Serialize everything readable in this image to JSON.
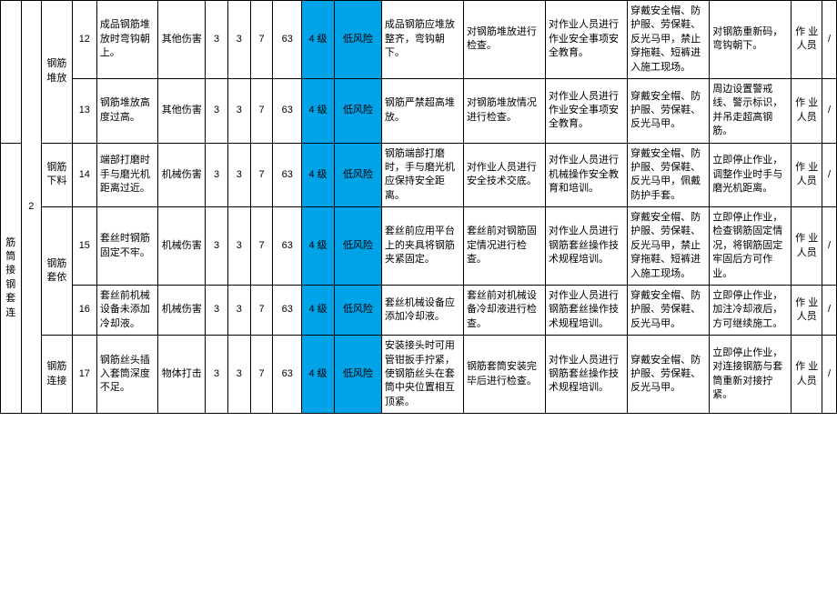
{
  "group2_id": "2",
  "group2_name": "筋 筒 接 钢 套 连",
  "subgroup_a": "钢筋 堆放",
  "subgroup_b1": "钢筋 下料",
  "subgroup_b2": "钢筋 套依",
  "subgroup_b3": "钢筋 连接",
  "rows": [
    {
      "idx": "12",
      "c4": "成品钢筋堆放时弯钩朝上。",
      "c5": "其他伤害",
      "c6": "3",
      "c7": "3",
      "c8": "7",
      "c9": "63",
      "c10": "4 级",
      "c11": "低风险",
      "c12": "成品钢筋应堆放整齐，弯钩朝下。",
      "c13": "对钢筋堆放进行检查。",
      "c14": "对作业人员进行作业安全事项安全教育。",
      "c15": "穿戴安全帽、防护服、劳保鞋、反光马甲，禁止穿拖鞋、短裤进入施工现场。",
      "c16": "对钢筋重新码，弯钩朝下。",
      "c17": "作 业 人员",
      "c18": "/"
    },
    {
      "idx": "13",
      "c4": "钢筋堆放高度过高。",
      "c5": "其他伤害",
      "c6": "3",
      "c7": "3",
      "c8": "7",
      "c9": "63",
      "c10": "4 级",
      "c11": "低风险",
      "c12": "钢筋严禁超高堆放。",
      "c13": "对钢筋堆放情况进行检查。",
      "c14": "对作业人员进行作业安全事项安全教育。",
      "c15": "穿戴安全帽、防护服、劳保鞋、反光马甲。",
      "c16": "周边设置警戒线、警示标识，并吊走超高钢筋。",
      "c17": "作 业 人员",
      "c18": "/"
    },
    {
      "idx": "14",
      "c4": "端部打磨时手与磨光机距离过近。",
      "c5": "机械伤害",
      "c6": "3",
      "c7": "3",
      "c8": "7",
      "c9": "63",
      "c10": "4 级",
      "c11": "低风险",
      "c12": "钢筋端部打磨时，手与磨光机应保持安全距离。",
      "c13": "对作业人员进行安全技术交底。",
      "c14": "对作业人员进行机械操作安全教育和培训。",
      "c15": "穿戴安全帽、防护服、劳保鞋、反光马甲，佩戴防护手套。",
      "c16": "立即停止作业，调整作业时手与磨光机距离。",
      "c17": "作 业 人员",
      "c18": "/"
    },
    {
      "idx": "15",
      "c4": "套丝时钢筋固定不牢。",
      "c5": "机械伤害",
      "c6": "3",
      "c7": "3",
      "c8": "7",
      "c9": "63",
      "c10": "4 级",
      "c11": "低风险",
      "c12": "套丝前应用平台上的夹具将钢筋夹紧固定。",
      "c13": "套丝前对钢筋固定情况进行检查。",
      "c14": "对作业人员进行钢筋套丝操作技术规程培训。",
      "c15": "穿戴安全帽、防护服、劳保鞋、反光马甲，禁止穿拖鞋、短裤进入施工现场。",
      "c16": "立即停止作业，检查钢筋固定情况，将钢筋固定牢固后方可作业。",
      "c17": "作 业 人员",
      "c18": "/"
    },
    {
      "idx": "16",
      "c4": "套丝前机械设备未添加冷却液。",
      "c5": "机械伤害",
      "c6": "3",
      "c7": "3",
      "c8": "7",
      "c9": "63",
      "c10": "4 级",
      "c11": "低风险",
      "c12": "套丝机械设备应添加冷却液。",
      "c13": "套丝前对机械设备冷却液进行检查。",
      "c14": "对作业人员进行钢筋套丝操作技术规程培训。",
      "c15": "穿戴安全帽、防护服、劳保鞋、反光马甲。",
      "c16": "立即停止作业，加注冷却液后，方可继续施工。",
      "c17": "作 业 人员",
      "c18": "/"
    },
    {
      "idx": "17",
      "c4": "钢筋丝头插入套筒深度不足。",
      "c5": "物体打击",
      "c6": "3",
      "c7": "3",
      "c8": "7",
      "c9": "63",
      "c10": "4 级",
      "c11": "低风险",
      "c12": "安装接头时可用管钳扳手拧紧，使钢筋丝头在套筒中央位置相互顶紧。",
      "c13": "钢筋套筒安装完毕后进行检查。",
      "c14": "对作业人员进行钢筋套丝操作技术规程培训。",
      "c15": "穿戴安全帽、防护服、劳保鞋、反光马甲。",
      "c16": "立即停止作业，对连接钢筋与套筒重新对接拧紧。",
      "c17": "作 业 人员",
      "c18": "/"
    }
  ]
}
